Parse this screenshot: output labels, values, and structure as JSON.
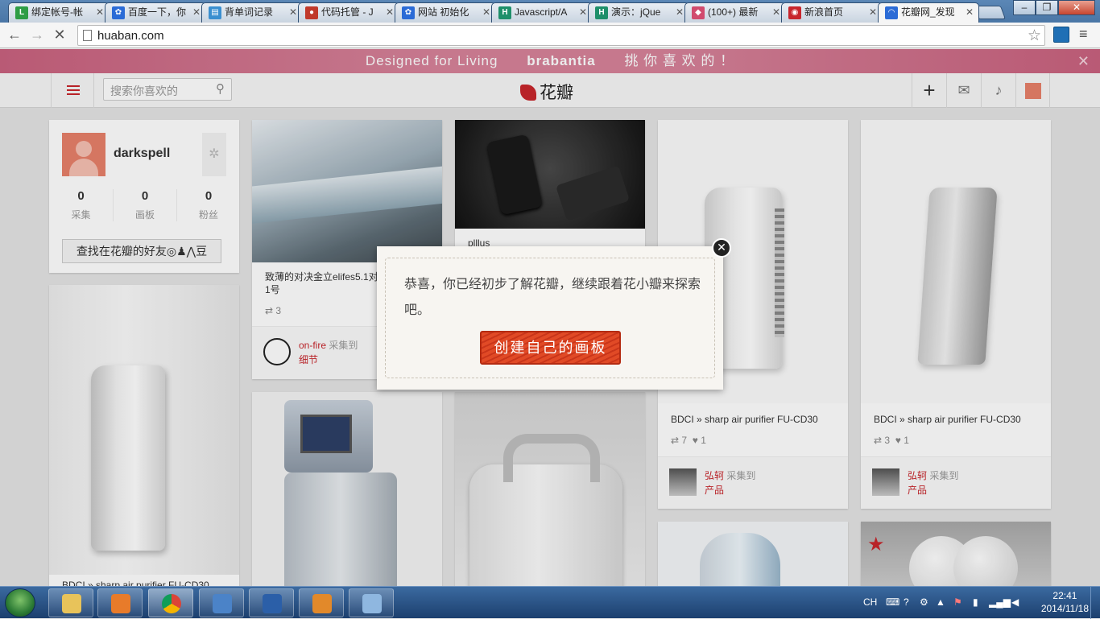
{
  "browser": {
    "tabs": [
      {
        "title": "绑定帐号-帐",
        "fav_color": "#2e9d45",
        "fav_text": "L"
      },
      {
        "title": "百度一下，你",
        "fav_color": "#2b6bd6",
        "fav_text": "✿"
      },
      {
        "title": "背单词记录",
        "fav_color": "#3a8fd0",
        "fav_text": "▤"
      },
      {
        "title": "代码托管 - J",
        "fav_color": "#c0392b",
        "fav_text": "●"
      },
      {
        "title": "网站 初始化",
        "fav_color": "#2b6bd6",
        "fav_text": "✿"
      },
      {
        "title": "Javascript/A",
        "fav_color": "#1e8f6a",
        "fav_text": "H"
      },
      {
        "title": "演示：jQue",
        "fav_color": "#1e8f6a",
        "fav_text": "H"
      },
      {
        "title": "(100+) 最新",
        "fav_color": "#d14b6e",
        "fav_text": "◆"
      },
      {
        "title": "新浪首页",
        "fav_color": "#c8262c",
        "fav_text": "◉"
      },
      {
        "title": "花瓣网_发现",
        "fav_color": "#2b6bd6",
        "fav_text": "◠"
      }
    ],
    "url": "huaban.com"
  },
  "banner": {
    "left": "Designed for Living",
    "brand": "brabantia",
    "right": "挑 你 喜 欢 的 ！"
  },
  "header": {
    "search_placeholder": "搜索你喜欢的",
    "logo_text": "花瓣"
  },
  "profile": {
    "username": "darkspell",
    "stats": [
      {
        "count": "0",
        "label": "采集"
      },
      {
        "count": "0",
        "label": "画板"
      },
      {
        "count": "0",
        "label": "粉丝"
      }
    ],
    "find_friends": "查找在花瓣的好友◎♟⋀豆"
  },
  "pins": [
    {
      "title": "致薄的对决金立elifes5.1对决",
      "title2": "1号",
      "repins": "3",
      "likes": "",
      "user": "on-fire",
      "action": "采集到",
      "board": "细节"
    },
    {
      "title": "plllus",
      "repins": "",
      "likes": ""
    },
    {
      "title": "BDCI » sharp air purifier FU-CD30",
      "repins": "7",
      "likes": "1",
      "user": "弘轲",
      "action": "采集到",
      "board": "产品"
    },
    {
      "title": "BDCI » sharp air purifier FU-CD30",
      "repins": "3",
      "likes": "1",
      "user": "弘轲",
      "action": "采集到",
      "board": "产品"
    },
    {
      "title": "BDCI » sharp air purifier FU-CD30",
      "repins": "",
      "likes": ""
    }
  ],
  "modal": {
    "message": "恭喜，你已经初步了解花瓣，继续跟着花小瓣来探索吧。",
    "button": "创建自己的画板"
  },
  "taskbar": {
    "lang": "CH",
    "time": "22:41",
    "date": "2014/11/18"
  }
}
